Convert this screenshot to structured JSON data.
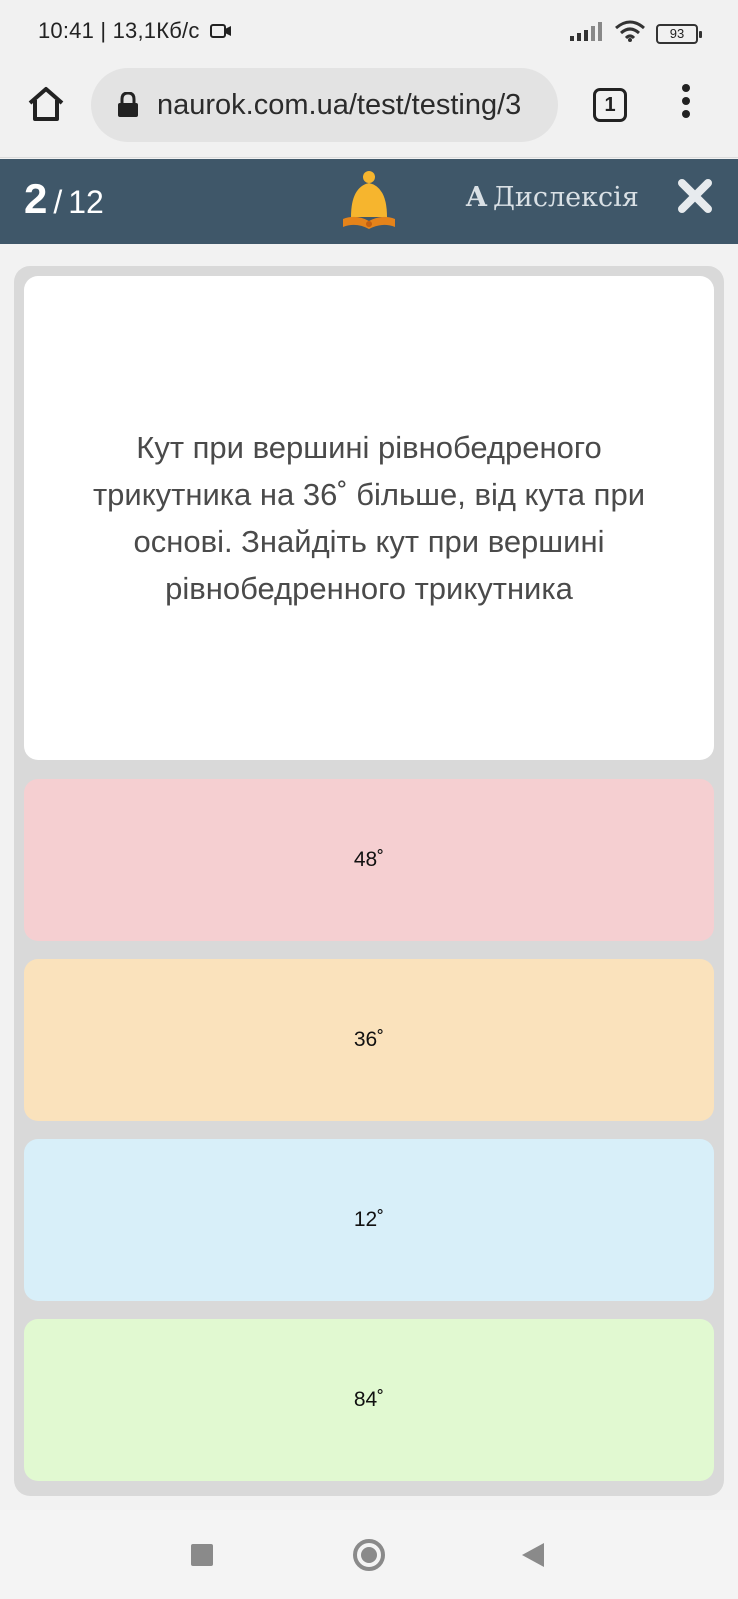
{
  "status_bar": {
    "time_speed": "10:41 | 13,1Кб/с",
    "battery": "93"
  },
  "browser": {
    "url": "naurok.com.ua/test/testing/3",
    "tab_count": "1"
  },
  "test_header": {
    "current": "2",
    "separator": "/",
    "total": "12",
    "dyslexia_letter": "A",
    "dyslexia_label": "Дислексія"
  },
  "question": {
    "text": "Кут при вершині рівнобедреного трикутника на 36˚ більше, від кута при основі. Знайдіть кут при вершині рівнобедренного трикутника"
  },
  "answers": [
    {
      "label": "48˚",
      "color": "#f5cfd1"
    },
    {
      "label": "36˚",
      "color": "#fae2bc"
    },
    {
      "label": "12˚",
      "color": "#d8eff9"
    },
    {
      "label": "84˚",
      "color": "#e1f9d1"
    }
  ],
  "colors": {
    "header_bg": "#3f5769",
    "bell": "#f6b52e"
  },
  "icons": {
    "home": "home-icon",
    "lock": "lock-icon",
    "menu": "more-vert-icon",
    "bell": "bell-icon",
    "close": "close-icon"
  }
}
